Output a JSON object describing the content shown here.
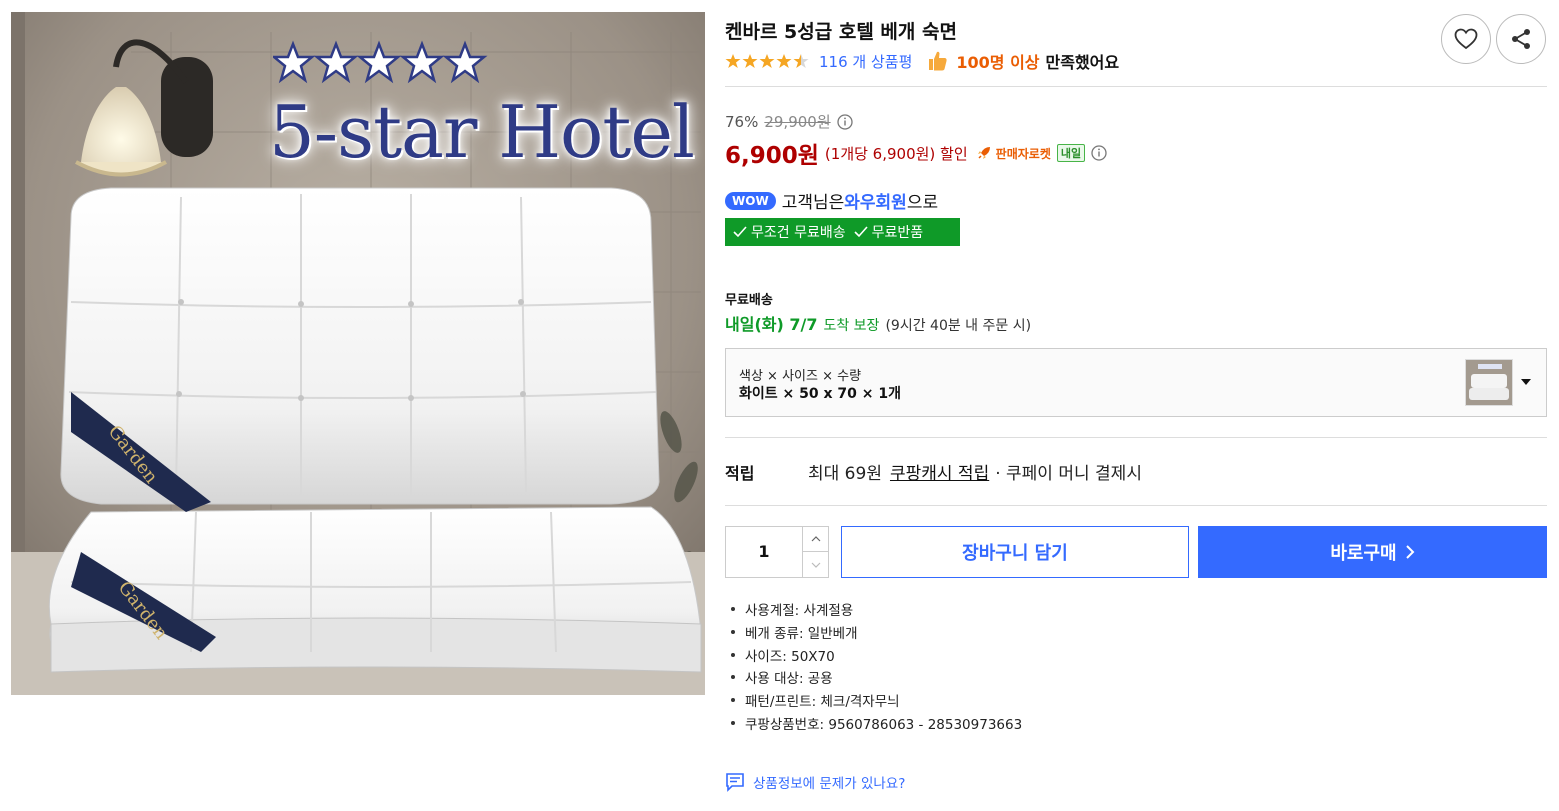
{
  "image": {
    "headline": "5-star Hotel",
    "star_count": 5,
    "label_text": "Garden"
  },
  "product": {
    "title": "켄바르 5성급 호텔 베개 숙면",
    "rating": 4.5,
    "review_count": "116 개 상품평",
    "satisfied_count": "100명 이상",
    "satisfied_text": "만족했어요"
  },
  "price": {
    "discount_rate": "76%",
    "original_price": "29,900원",
    "sale_price": "6,900원",
    "unit_price": "(1개당 6,900원) 할인",
    "rocket_label": "판매자로켓",
    "tomorrow_badge": "내일"
  },
  "wow": {
    "badge": "WOW",
    "prefix": "고객님은 ",
    "member": "와우회원",
    "suffix": "으로",
    "benefit_1": "무조건 무료배송",
    "benefit_2": "무료반품"
  },
  "shipping": {
    "label": "무료배송",
    "date": "내일(화) 7/7",
    "guarantee": "도착 보장",
    "note": "(9시간 40분 내 주문 시)"
  },
  "option": {
    "label": "색상 × 사이즈 × 수량",
    "value": "화이트 × 50 x 70 × 1개"
  },
  "reward": {
    "label": "적립",
    "max": "최대 69원",
    "link": "쿠팡캐시 적립",
    "rest": "· 쿠페이 머니 결제시"
  },
  "purchase": {
    "quantity": "1",
    "cart_label": "장바구니 담기",
    "buy_label": "바로구매"
  },
  "specs": [
    "사용계절: 사계절용",
    "베개 종류: 일반베개",
    "사이즈: 50X70",
    "사용 대상: 공용",
    "패턴/프린트: 체크/격자무늬",
    "쿠팡상품번호: 9560786063 - 28530973663"
  ],
  "report": {
    "label": "상품정보에 문제가 있나요?"
  },
  "colors": {
    "accent": "#346aff",
    "price_red": "#ae0000",
    "green": "#0f9a28",
    "orange": "#ea5d03",
    "star": "#f5a623"
  },
  "icons": {
    "wishlist": "heart-icon",
    "share": "share-icon",
    "thumb": "thumbs-up-icon",
    "info": "info-icon",
    "rocket": "rocket-icon",
    "check": "check-icon",
    "dropdown": "caret-down-icon",
    "buy_arrow": "chevron-right-icon",
    "report": "comment-icon"
  }
}
